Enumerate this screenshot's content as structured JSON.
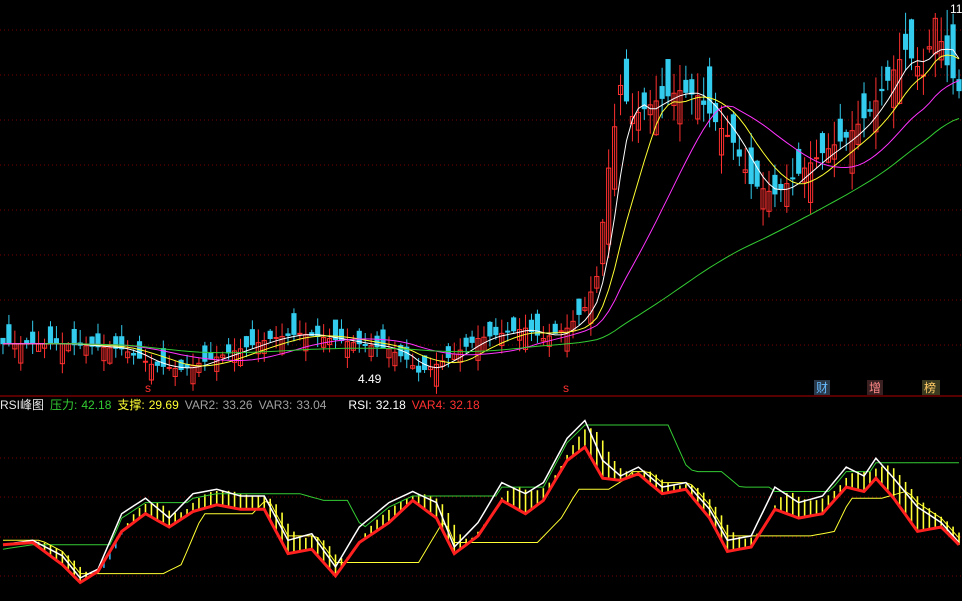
{
  "colors": {
    "background": "#000000",
    "grid": "#7a0000",
    "divider": "#b00000",
    "up": "#ff3030",
    "down": "#33ccee",
    "ma5": "#ffffff",
    "ma10": "#ffff33",
    "ma20": "#ff33ff",
    "ma60": "#33cc33",
    "rsi": "#ffffff",
    "var4": "#ff2020",
    "pressure": "#33cc33",
    "support": "#ffff33",
    "band_up": "#ffff33",
    "band_down": "#33aaee"
  },
  "legend": {
    "title": "RSI峰图",
    "pressure_label": "压力:",
    "pressure_value": "42.18",
    "support_label": "支撑:",
    "support_value": "29.69",
    "var2_label": "VAR2:",
    "var2_value": "33.26",
    "var3_label": "VAR3:",
    "var3_value": "33.04",
    "rsi_label": "RSI:",
    "rsi_value": "32.18",
    "var4_label": "VAR4:",
    "var4_value": "32.18"
  },
  "annotations": {
    "low_price": "4.49",
    "high_price": "11",
    "marker_s1": "s",
    "marker_s2": "s",
    "badge_cai": "财",
    "badge_zeng": "增",
    "badge_bang": "榜"
  },
  "chart_data": [
    {
      "type": "candlestick",
      "title": "",
      "series": [
        {
          "name": "price",
          "key_points": [
            [
              0,
              5.1
            ],
            [
              10,
              5.1
            ],
            [
              20,
              5.0
            ],
            [
              25,
              4.7
            ],
            [
              30,
              4.6
            ],
            [
              35,
              4.8
            ],
            [
              40,
              5.0
            ],
            [
              45,
              5.2
            ],
            [
              50,
              5.3
            ],
            [
              55,
              5.2
            ],
            [
              60,
              5.1
            ],
            [
              65,
              5.0
            ],
            [
              68,
              4.8
            ],
            [
              70,
              4.55
            ],
            [
              73,
              4.7
            ],
            [
              76,
              4.9
            ],
            [
              80,
              5.2
            ],
            [
              84,
              5.3
            ],
            [
              88,
              5.4
            ],
            [
              91,
              5.2
            ],
            [
              95,
              5.4
            ],
            [
              98,
              5.8
            ],
            [
              100,
              6.4
            ],
            [
              102,
              8.5
            ],
            [
              104,
              10.1
            ],
            [
              106,
              9.5
            ],
            [
              110,
              9.8
            ],
            [
              114,
              10.0
            ],
            [
              117,
              9.9
            ],
            [
              120,
              9.4
            ],
            [
              123,
              9.0
            ],
            [
              126,
              8.2
            ],
            [
              130,
              8.0
            ],
            [
              134,
              8.4
            ],
            [
              138,
              8.8
            ],
            [
              142,
              9.1
            ],
            [
              146,
              9.6
            ],
            [
              150,
              10.4
            ],
            [
              152,
              10.8
            ],
            [
              155,
              10.3
            ],
            [
              157,
              11.4
            ],
            [
              159,
              10.5
            ],
            [
              161,
              10.0
            ]
          ]
        }
      ],
      "moving_averages": [
        "MA5",
        "MA10",
        "MA20",
        "MA60"
      ],
      "annotations": [
        "4.49",
        "11"
      ]
    },
    {
      "type": "line",
      "title": "RSI峰图",
      "series": [
        {
          "name": "RSI",
          "key_points": [
            [
              0,
              32
            ],
            [
              5,
              34
            ],
            [
              10,
              27
            ],
            [
              13,
              17
            ],
            [
              16,
              21
            ],
            [
              20,
              46
            ],
            [
              24,
              53
            ],
            [
              28,
              44
            ],
            [
              32,
              55
            ],
            [
              36,
              57
            ],
            [
              40,
              54
            ],
            [
              44,
              54
            ],
            [
              48,
              34
            ],
            [
              52,
              37
            ],
            [
              56,
              22
            ],
            [
              60,
              40
            ],
            [
              65,
              51
            ],
            [
              69,
              56
            ],
            [
              73,
              51
            ],
            [
              76,
              31
            ],
            [
              80,
              42
            ],
            [
              84,
              60
            ],
            [
              88,
              55
            ],
            [
              91,
              60
            ],
            [
              95,
              80
            ],
            [
              98,
              88
            ],
            [
              101,
              70
            ],
            [
              104,
              63
            ],
            [
              107,
              67
            ],
            [
              111,
              58
            ],
            [
              115,
              60
            ],
            [
              119,
              48
            ],
            [
              122,
              34
            ],
            [
              126,
              36
            ],
            [
              130,
              58
            ],
            [
              134,
              51
            ],
            [
              138,
              54
            ],
            [
              142,
              67
            ],
            [
              145,
              63
            ],
            [
              147,
              71
            ],
            [
              150,
              62
            ],
            [
              154,
              49
            ],
            [
              158,
              42
            ],
            [
              161,
              33
            ]
          ]
        },
        {
          "name": "VAR4",
          "key_points": [
            [
              0,
              32
            ],
            [
              5,
              33
            ],
            [
              10,
              23
            ],
            [
              13,
              15
            ],
            [
              16,
              20
            ],
            [
              20,
              38
            ],
            [
              24,
              46
            ],
            [
              28,
              40
            ],
            [
              32,
              47
            ],
            [
              36,
              50
            ],
            [
              40,
              48
            ],
            [
              44,
              48
            ],
            [
              48,
              28
            ],
            [
              52,
              30
            ],
            [
              56,
              18
            ],
            [
              60,
              33
            ],
            [
              65,
              42
            ],
            [
              69,
              52
            ],
            [
              73,
              44
            ],
            [
              76,
              28
            ],
            [
              80,
              36
            ],
            [
              84,
              52
            ],
            [
              88,
              46
            ],
            [
              91,
              52
            ],
            [
              95,
              70
            ],
            [
              98,
              76
            ],
            [
              101,
              62
            ],
            [
              104,
              61
            ],
            [
              107,
              64
            ],
            [
              111,
              55
            ],
            [
              115,
              57
            ],
            [
              119,
              44
            ],
            [
              122,
              29
            ],
            [
              126,
              31
            ],
            [
              130,
              48
            ],
            [
              134,
              44
            ],
            [
              138,
              46
            ],
            [
              142,
              58
            ],
            [
              145,
              56
            ],
            [
              147,
              62
            ],
            [
              150,
              53
            ],
            [
              154,
              38
            ],
            [
              158,
              40
            ],
            [
              161,
              32
            ]
          ]
        }
      ],
      "legend_values": {
        "压力": 42.18,
        "支撑": 29.69,
        "VAR2": 33.26,
        "VAR3": 33.04,
        "RSI": 32.18,
        "VAR4": 32.18
      }
    }
  ]
}
